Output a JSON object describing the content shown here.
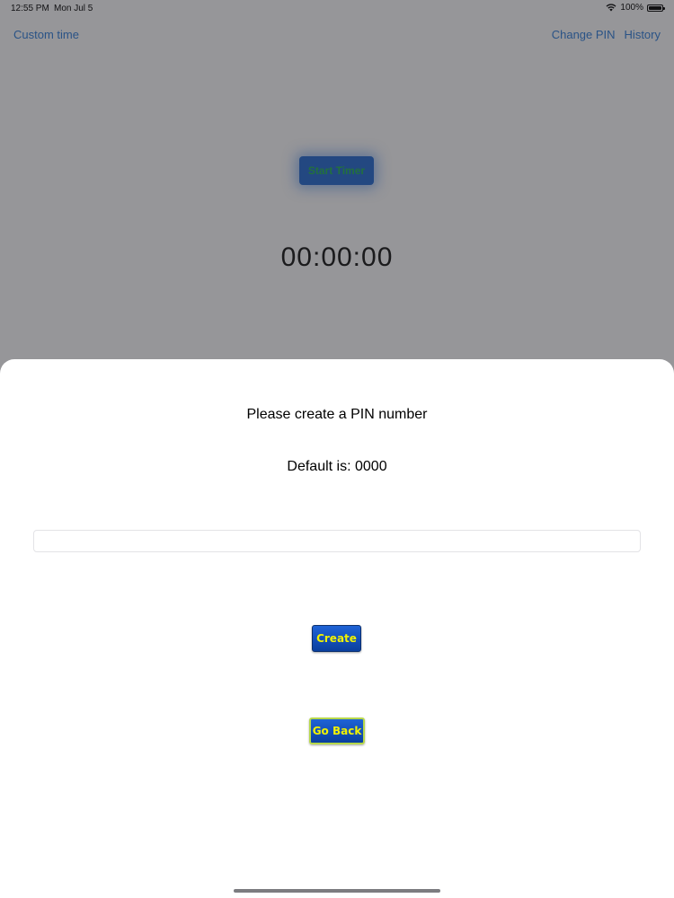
{
  "status_bar": {
    "time": "12:55 PM",
    "date": "Mon Jul 5",
    "battery": "100%",
    "icons": [
      "wifi-icon",
      "battery-icon"
    ]
  },
  "background_app": {
    "nav": {
      "left_label": "Custom time",
      "right_items": [
        "Change PIN",
        "History"
      ]
    },
    "start_timer_label": "Start Timer",
    "timer_value": "00:00:00"
  },
  "sheet": {
    "title": "Please create a PIN number",
    "default_text": "Default is: 0000",
    "pin_input": {
      "value": "",
      "placeholder": ""
    },
    "create_label": "Create",
    "go_back_label": "Go Back"
  },
  "colors": {
    "nav_link": "#3b82d6",
    "button_blue": "#0a3f9e",
    "button_text": "#f2f200",
    "start_timer_text": "#2fb35a"
  }
}
